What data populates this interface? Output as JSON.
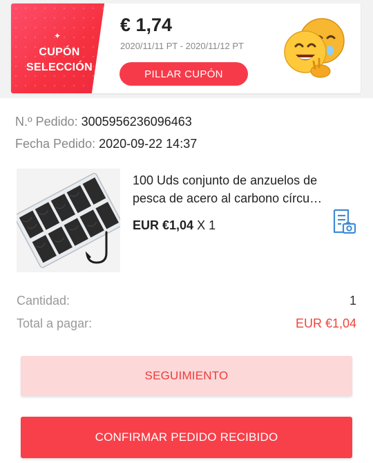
{
  "coupon": {
    "label_line1": "CUPÓN",
    "label_line2": "SELECCIÓN",
    "amount": "€ 1,74",
    "validity": "2020/11/11 PT - 2020/11/12 PT",
    "button_label": "PILLAR CUPÓN",
    "accent_color": "#f73a4a",
    "icon": "hugging-emoji-icon"
  },
  "order": {
    "number_label": "N.º Pedido:",
    "number_value": "3005956236096463",
    "date_label": "Fecha Pedido:",
    "date_value": "2020-09-22 14:37"
  },
  "product": {
    "image_icon": "fishing-hooks-box-image",
    "title_line1": "100 Uds conjunto de anzuelos de",
    "title_line2": "pesca de acero al carbono círcu…",
    "price": "EUR €1,04",
    "quantity": "X 1",
    "receipt_icon": "receipt-camera-icon"
  },
  "summary": {
    "quantity_label": "Cantidad:",
    "quantity_value": "1",
    "total_label": "Total a pagar:",
    "total_value": "EUR €1,04",
    "total_color": "#f0443c"
  },
  "actions": {
    "tracking_label": "SEGUIMIENTO",
    "confirm_label": "CONFIRMAR PEDIDO RECIBIDO"
  }
}
